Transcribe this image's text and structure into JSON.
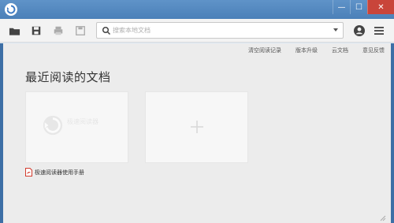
{
  "window": {
    "controls": {
      "minimize": "—",
      "maximize": "☐",
      "close": "✕"
    }
  },
  "toolbar": {
    "icons": [
      "folder-open-icon",
      "save-icon",
      "print-icon",
      "save-as-icon",
      "user-icon",
      "menu-icon"
    ],
    "search": {
      "placeholder": "搜索本地文档",
      "value": ""
    }
  },
  "top_links": [
    "清空阅读记录",
    "版本升级",
    "云文档",
    "意见反馈"
  ],
  "main": {
    "section_title": "最近阅读的文档",
    "recent_docs": [
      {
        "name": "极速阅读器使用手册",
        "type": "pdf"
      }
    ],
    "watermark_text": "极速阅读器",
    "watermark_sub": "",
    "add_card_label": "+"
  },
  "colors": {
    "titlebar": "#4b80b8",
    "close_button": "#c9453a",
    "background": "#ececec",
    "pdf_red": "#d23b2d"
  }
}
